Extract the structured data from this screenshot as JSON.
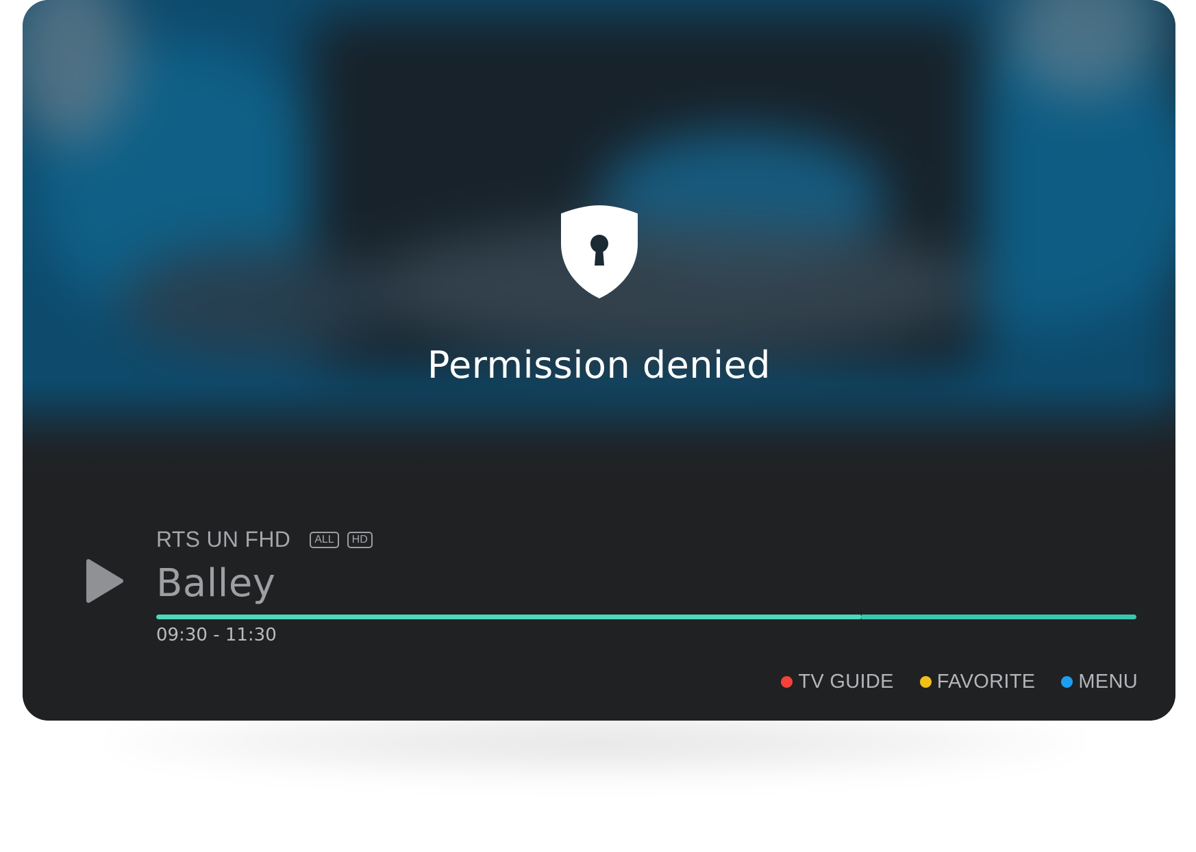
{
  "player": {
    "message": "Permission denied",
    "channel": {
      "name": "RTS UN FHD",
      "badges": [
        "ALL",
        "HD"
      ]
    },
    "program": {
      "title": "Balley",
      "time_range": "09:30 - 11:30",
      "progress_fraction": 0.72
    },
    "shortcuts": [
      {
        "label": "TV GUIDE",
        "color": "#f2423a"
      },
      {
        "label": "FAVORITE",
        "color": "#f2c017"
      },
      {
        "label": "MENU",
        "color": "#1e9ef0"
      }
    ]
  },
  "colors": {
    "accent": "#4dd7bd",
    "background": "#202123"
  },
  "icons": {
    "status": "shield-lock-icon",
    "playback": "play-icon"
  }
}
